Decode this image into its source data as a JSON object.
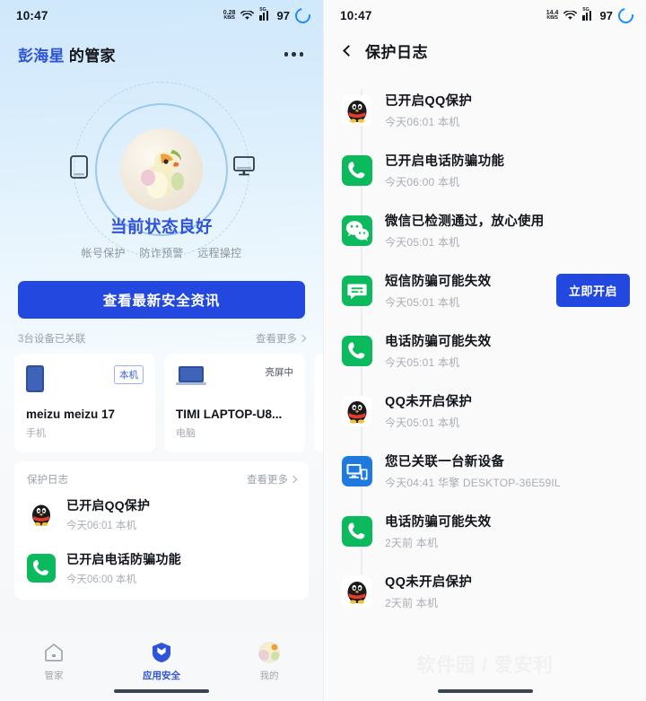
{
  "left": {
    "statusbar": {
      "time": "10:47",
      "net_speed_value": "0.28",
      "net_speed_unit": "KB/S",
      "signal_gen": "5G",
      "battery": "97"
    },
    "header": {
      "user_name": "彭海星",
      "title_suffix": " 的管家",
      "more_icon": "more-dots-icon"
    },
    "hero": {
      "status_text": "当前状态良好",
      "tags": [
        "帐号保护",
        "防诈预警",
        "远程操控"
      ],
      "left_icon": "phone-icon",
      "right_icon": "monitor-icon"
    },
    "cta_label": "查看最新安全资讯",
    "devices_section": {
      "title": "3台设备已关联",
      "more_label": "查看更多"
    },
    "devices": [
      {
        "icon": "phone-device-icon",
        "badge": "本机",
        "badge_style": "outline",
        "name": "meizu meizu 17",
        "type": "手机"
      },
      {
        "icon": "laptop-device-icon",
        "badge": "亮屏中",
        "badge_style": "plain",
        "name": "TIMI LAPTOP-U8...",
        "type": "电脑"
      }
    ],
    "log_section": {
      "title": "保护日志",
      "more_label": "查看更多"
    },
    "log_items": [
      {
        "icon": "qq-icon",
        "title": "已开启QQ保护",
        "subtitle": "今天06:01 本机"
      },
      {
        "icon": "phone-call-icon",
        "title": "已开启电话防骗功能",
        "subtitle": "今天06:00 本机"
      }
    ],
    "tabs": [
      {
        "icon": "home-icon",
        "label": "管家",
        "active": false
      },
      {
        "icon": "shield-icon",
        "label": "应用安全",
        "active": true
      },
      {
        "icon": "avatar-icon",
        "label": "我的",
        "active": false
      }
    ]
  },
  "right": {
    "statusbar": {
      "time": "10:47",
      "net_speed_value": "14.4",
      "net_speed_unit": "KB/S",
      "signal_gen": "5G",
      "battery": "97"
    },
    "header": {
      "back_icon": "back-chevron-icon",
      "title": "保护日志"
    },
    "timeline": [
      {
        "icon": "qq-icon",
        "title": "已开启QQ保护",
        "subtitle": "今天06:01 本机",
        "action": null
      },
      {
        "icon": "phone-call-icon",
        "title": "已开启电话防骗功能",
        "subtitle": "今天06:00 本机",
        "action": null
      },
      {
        "icon": "wechat-icon",
        "title": "微信已检测通过，放心使用",
        "subtitle": "今天05:01 本机",
        "action": null
      },
      {
        "icon": "sms-icon",
        "title": "短信防骗可能失效",
        "subtitle": "今天05:01 本机",
        "action": "立即开启"
      },
      {
        "icon": "phone-call-icon",
        "title": "电话防骗可能失效",
        "subtitle": "今天05:01 本机",
        "action": null
      },
      {
        "icon": "qq-icon",
        "title": "QQ未开启保护",
        "subtitle": "今天05:01 本机",
        "action": null
      },
      {
        "icon": "new-device-icon",
        "title": "您已关联一台新设备",
        "subtitle": "今天04:41 华擎 DESKTOP-36E59IL",
        "action": null
      },
      {
        "icon": "phone-call-icon",
        "title": "电话防骗可能失效",
        "subtitle": "2天前 本机",
        "action": null
      },
      {
        "icon": "qq-icon",
        "title": "QQ未开启保护",
        "subtitle": "2天前 本机",
        "action": null
      }
    ],
    "watermark": "软件园 / 爱安利"
  },
  "colors": {
    "brand_blue": "#2348e0",
    "accent_blue": "#2f53d9",
    "green": "#0bba5c",
    "device_blue": "#1f7ae0",
    "muted": "#a9aeb6"
  }
}
